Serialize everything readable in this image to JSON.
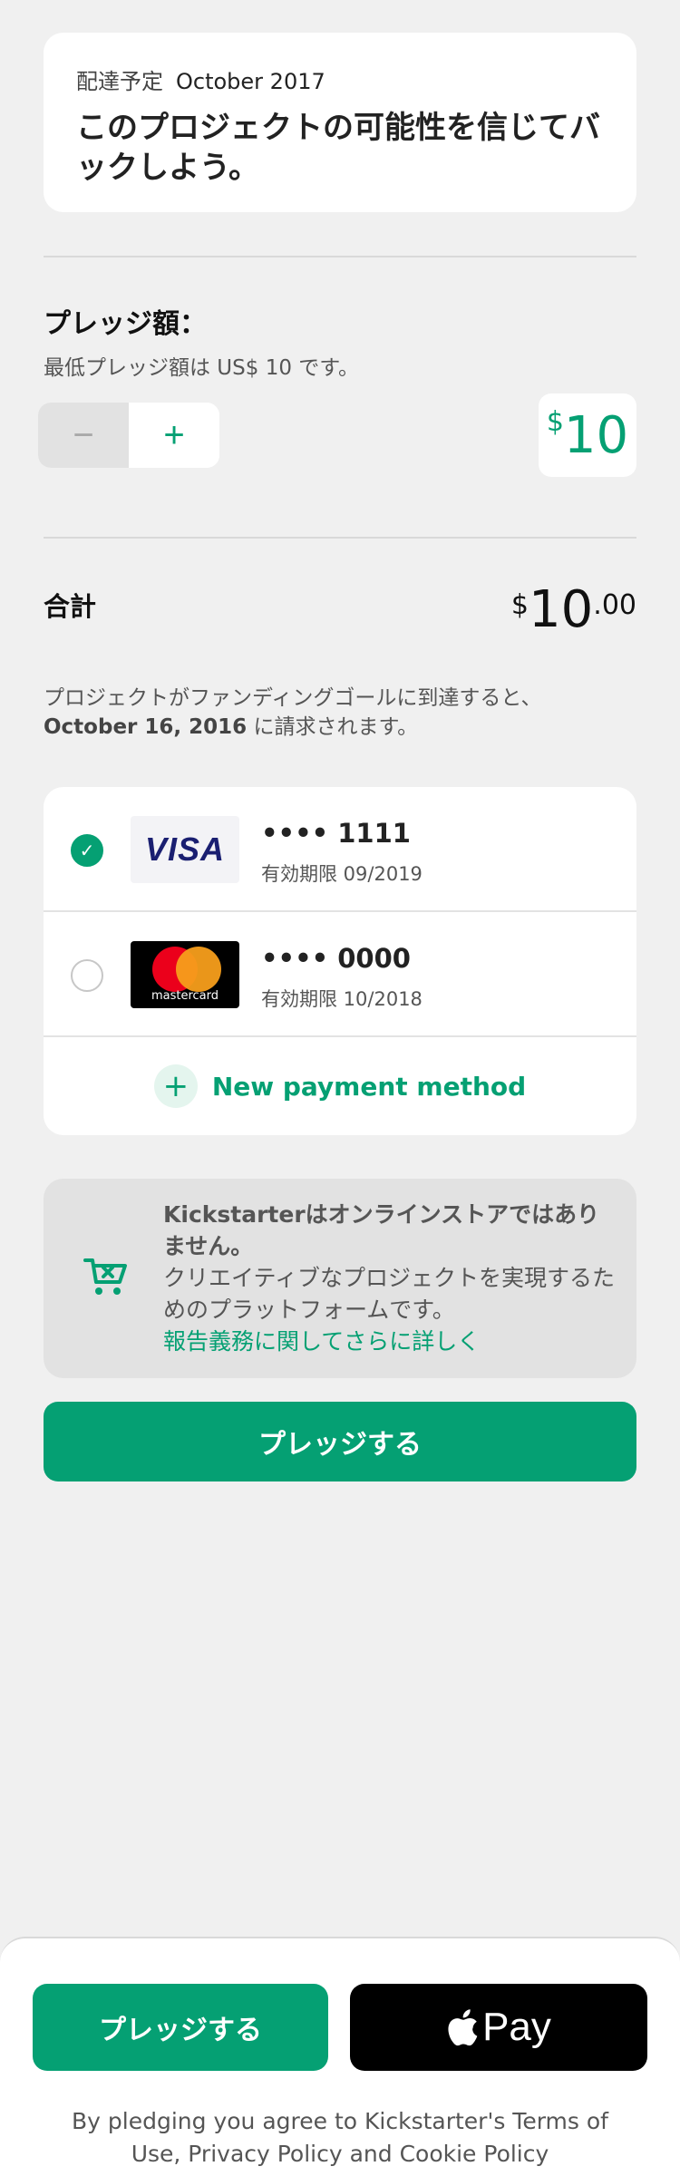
{
  "reward": {
    "delivery_label": "配達予定",
    "delivery_date": "October 2017",
    "title": "このプロジェクトの可能性を信じてバックしよう。"
  },
  "pledge": {
    "label": "プレッジ額：",
    "minimum_note": "最低プレッジ額は US$ 10 です。",
    "minus_symbol": "−",
    "plus_symbol": "+",
    "currency_symbol": "$",
    "amount": "10"
  },
  "total": {
    "label": "合計",
    "currency_symbol": "$",
    "amount": "10",
    "cents": ".00"
  },
  "charge_note": {
    "prefix": "プロジェクトがファンディングゴールに到達すると、",
    "date": "October 16, 2016",
    "suffix": " に請求されます。"
  },
  "payment_methods": {
    "cards": [
      {
        "brand": "VISA",
        "number": "•••• 1111",
        "expiry": "有効期限 09/2019",
        "selected": true
      },
      {
        "brand": "mastercard",
        "number": "•••• 0000",
        "expiry": "有効期限 10/2018",
        "selected": false
      }
    ],
    "new_label": "New payment method",
    "check_symbol": "✓"
  },
  "notice": {
    "line_bold": "Kickstarterはオンラインストアではありません。",
    "line_regular": "クリエイティブなプロジェクトを実現するためのプラットフォームです。",
    "link": "報告義務に関してさらに詳しく",
    "icon": "cart-x-icon"
  },
  "pledge_button": "プレッジする",
  "bottom_sheet": {
    "pledge_button": "プレッジする",
    "apple_pay_label": "Pay",
    "terms": "By pledging you agree to Kickstarter's Terms of Use, Privacy Policy and Cookie Policy"
  },
  "colors": {
    "accent": "#05a073",
    "background": "#f0f0f0"
  }
}
